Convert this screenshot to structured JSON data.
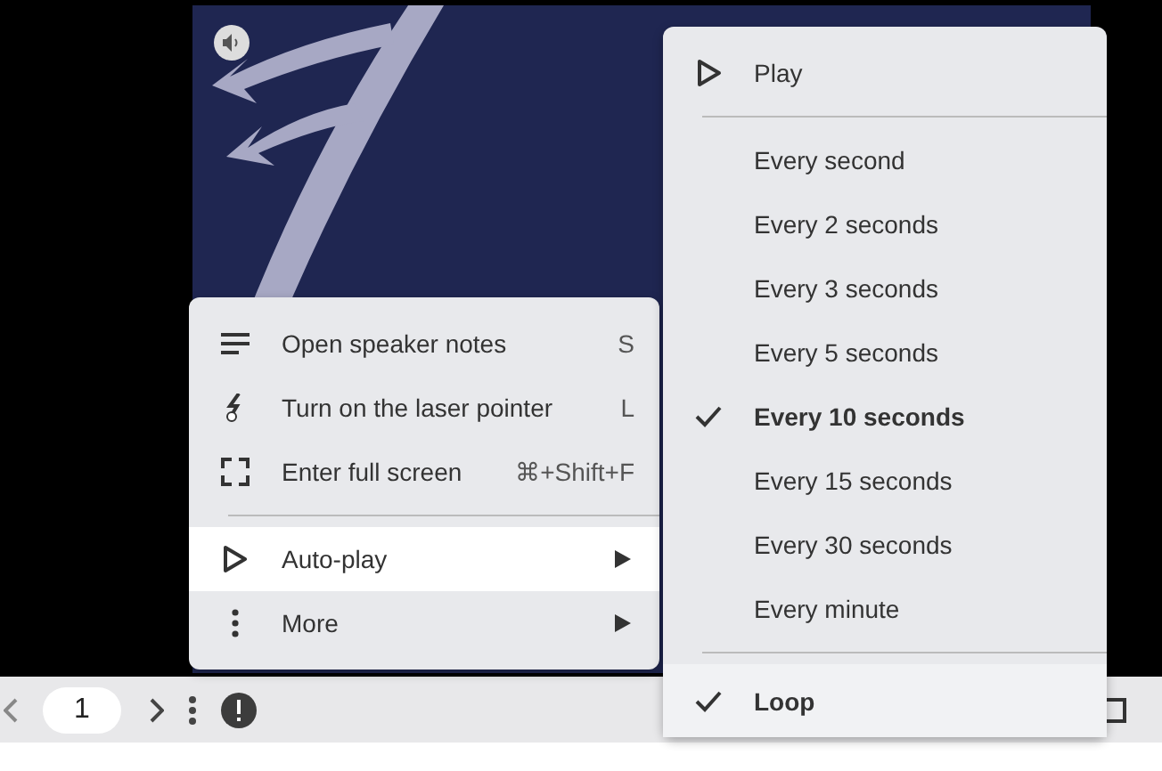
{
  "toolbar": {
    "page": "1"
  },
  "menu": {
    "items": [
      {
        "kind": "shortcut",
        "label": "Open speaker notes",
        "shortcut": "S",
        "selected": false
      },
      {
        "kind": "shortcut",
        "label": "Turn on the laser pointer",
        "shortcut": "L",
        "selected": false
      },
      {
        "kind": "shortcut",
        "label": "Enter full screen",
        "shortcut": "⌘+Shift+F",
        "selected": false
      },
      {
        "kind": "submenu",
        "label": "Auto-play",
        "selected": true
      },
      {
        "kind": "submenu",
        "label": "More",
        "selected": false
      }
    ]
  },
  "autoplay_menu": {
    "play": "Play",
    "intervals": [
      {
        "label": "Every second",
        "checked": false
      },
      {
        "label": "Every 2 seconds",
        "checked": false
      },
      {
        "label": "Every 3 seconds",
        "checked": false
      },
      {
        "label": "Every 5 seconds",
        "checked": false
      },
      {
        "label": "Every 10 seconds",
        "checked": true
      },
      {
        "label": "Every 15 seconds",
        "checked": false
      },
      {
        "label": "Every 30 seconds",
        "checked": false
      },
      {
        "label": "Every minute",
        "checked": false
      }
    ],
    "loop": {
      "label": "Loop",
      "checked": true,
      "selected": true
    }
  }
}
